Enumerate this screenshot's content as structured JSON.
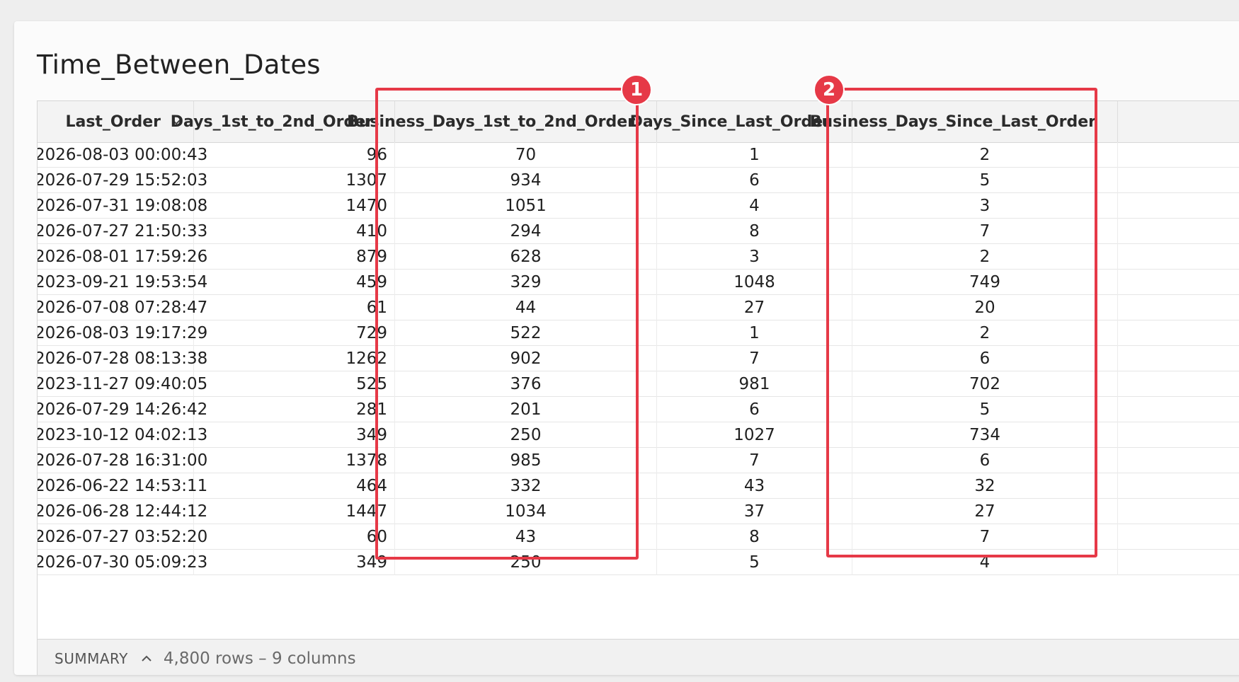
{
  "title": "Time_Between_Dates",
  "columns": [
    "Last_Order",
    "Days_1st_to_2nd_Order",
    "Business_Days_1st_to_2nd_Order",
    "Days_Since_Last_Order",
    "Business_Days_Since_Last_Order"
  ],
  "rows": [
    [
      "2026-08-03 00:00:43",
      "96",
      "70",
      "1",
      "2"
    ],
    [
      "2026-07-29 15:52:03",
      "1307",
      "934",
      "6",
      "5"
    ],
    [
      "2026-07-31 19:08:08",
      "1470",
      "1051",
      "4",
      "3"
    ],
    [
      "2026-07-27 21:50:33",
      "410",
      "294",
      "8",
      "7"
    ],
    [
      "2026-08-01 17:59:26",
      "879",
      "628",
      "3",
      "2"
    ],
    [
      "2023-09-21 19:53:54",
      "459",
      "329",
      "1048",
      "749"
    ],
    [
      "2026-07-08 07:28:47",
      "61",
      "44",
      "27",
      "20"
    ],
    [
      "2026-08-03 19:17:29",
      "729",
      "522",
      "1",
      "2"
    ],
    [
      "2026-07-28 08:13:38",
      "1262",
      "902",
      "7",
      "6"
    ],
    [
      "2023-11-27 09:40:05",
      "525",
      "376",
      "981",
      "702"
    ],
    [
      "2026-07-29 14:26:42",
      "281",
      "201",
      "6",
      "5"
    ],
    [
      "2023-10-12 04:02:13",
      "349",
      "250",
      "1027",
      "734"
    ],
    [
      "2026-07-28 16:31:00",
      "1378",
      "985",
      "7",
      "6"
    ],
    [
      "2026-06-22 14:53:11",
      "464",
      "332",
      "43",
      "32"
    ],
    [
      "2026-06-28 12:44:12",
      "1447",
      "1034",
      "37",
      "27"
    ],
    [
      "2026-07-27 03:52:20",
      "60",
      "43",
      "8",
      "7"
    ],
    [
      "2026-07-30 05:09:23",
      "349",
      "250",
      "5",
      "4"
    ]
  ],
  "summary": {
    "label": "SUMMARY",
    "info": "4,800 rows – 9 columns"
  },
  "badges": [
    "1",
    "2"
  ],
  "colors": {
    "highlight": "#e63947",
    "header_bg": "#f3f3f3",
    "summary_bg": "#f1f1f1"
  },
  "icons": {
    "column_menu": "chevron-down-icon",
    "summary_toggle": "chevron-up-icon"
  }
}
